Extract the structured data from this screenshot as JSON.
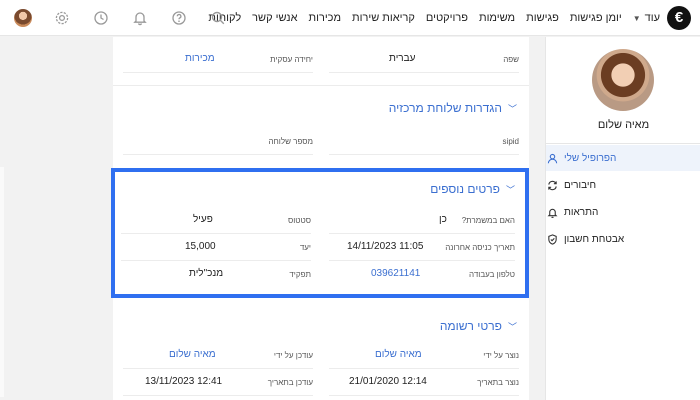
{
  "topbar": {
    "logo": "€",
    "nav": [
      "לקוחות",
      "אנשי קשר",
      "מכירות",
      "קריאות שירות",
      "פרויקטים",
      "משימות",
      "פגישות",
      "יומן פגישות"
    ],
    "more": "עוד"
  },
  "sidebar": {
    "name": "מאיה שלום",
    "items": [
      {
        "label": "הפרופיל שלי",
        "icon": "user-icon",
        "active": true
      },
      {
        "label": "חיבורים",
        "icon": "sync-icon",
        "active": false
      },
      {
        "label": "התראות",
        "icon": "bell-icon",
        "active": false
      },
      {
        "label": "אבטחת חשבון",
        "icon": "shield-icon",
        "active": false
      }
    ]
  },
  "top_fields": {
    "language_label": "שפה",
    "language_value": "עברית",
    "unit_label": "יחידה עסקית",
    "unit_value": "מכירות"
  },
  "central_send": {
    "title": "הגדרות שלוחת מרכזיה",
    "sipid_label": "sipid",
    "ext_label": "מספר שלוחה"
  },
  "extra_details": {
    "title": "פרטים נוספים",
    "shift_label": "האם במשמרת?",
    "shift_value": "כן",
    "status_label": "סטטוס",
    "status_value": "פעיל",
    "last_login_label": "תאריך כניסה אחרונה",
    "last_login_value": "11:05 14/11/2023",
    "target_label": "יעד",
    "target_value": "15,000",
    "work_phone_label": "טלפון בעבודה",
    "work_phone_value": "039621141",
    "role_label": "תפקיד",
    "role_value": "מנכ\"לית"
  },
  "record_details": {
    "title": "פרטי רשומה",
    "created_by_label": "נוצר על ידי",
    "created_by_value": "מאיה שלום",
    "updated_by_label": "עודכן על ידי",
    "updated_by_value": "מאיה שלום",
    "created_at_label": "נוצר בתאריך",
    "created_at_value": "12:14 21/01/2020",
    "updated_at_label": "עודכן בתאריך",
    "updated_at_value": "12:41 13/11/2023"
  },
  "colors": {
    "accent": "#3b6fd0",
    "highlight": "#2f6ff0"
  }
}
